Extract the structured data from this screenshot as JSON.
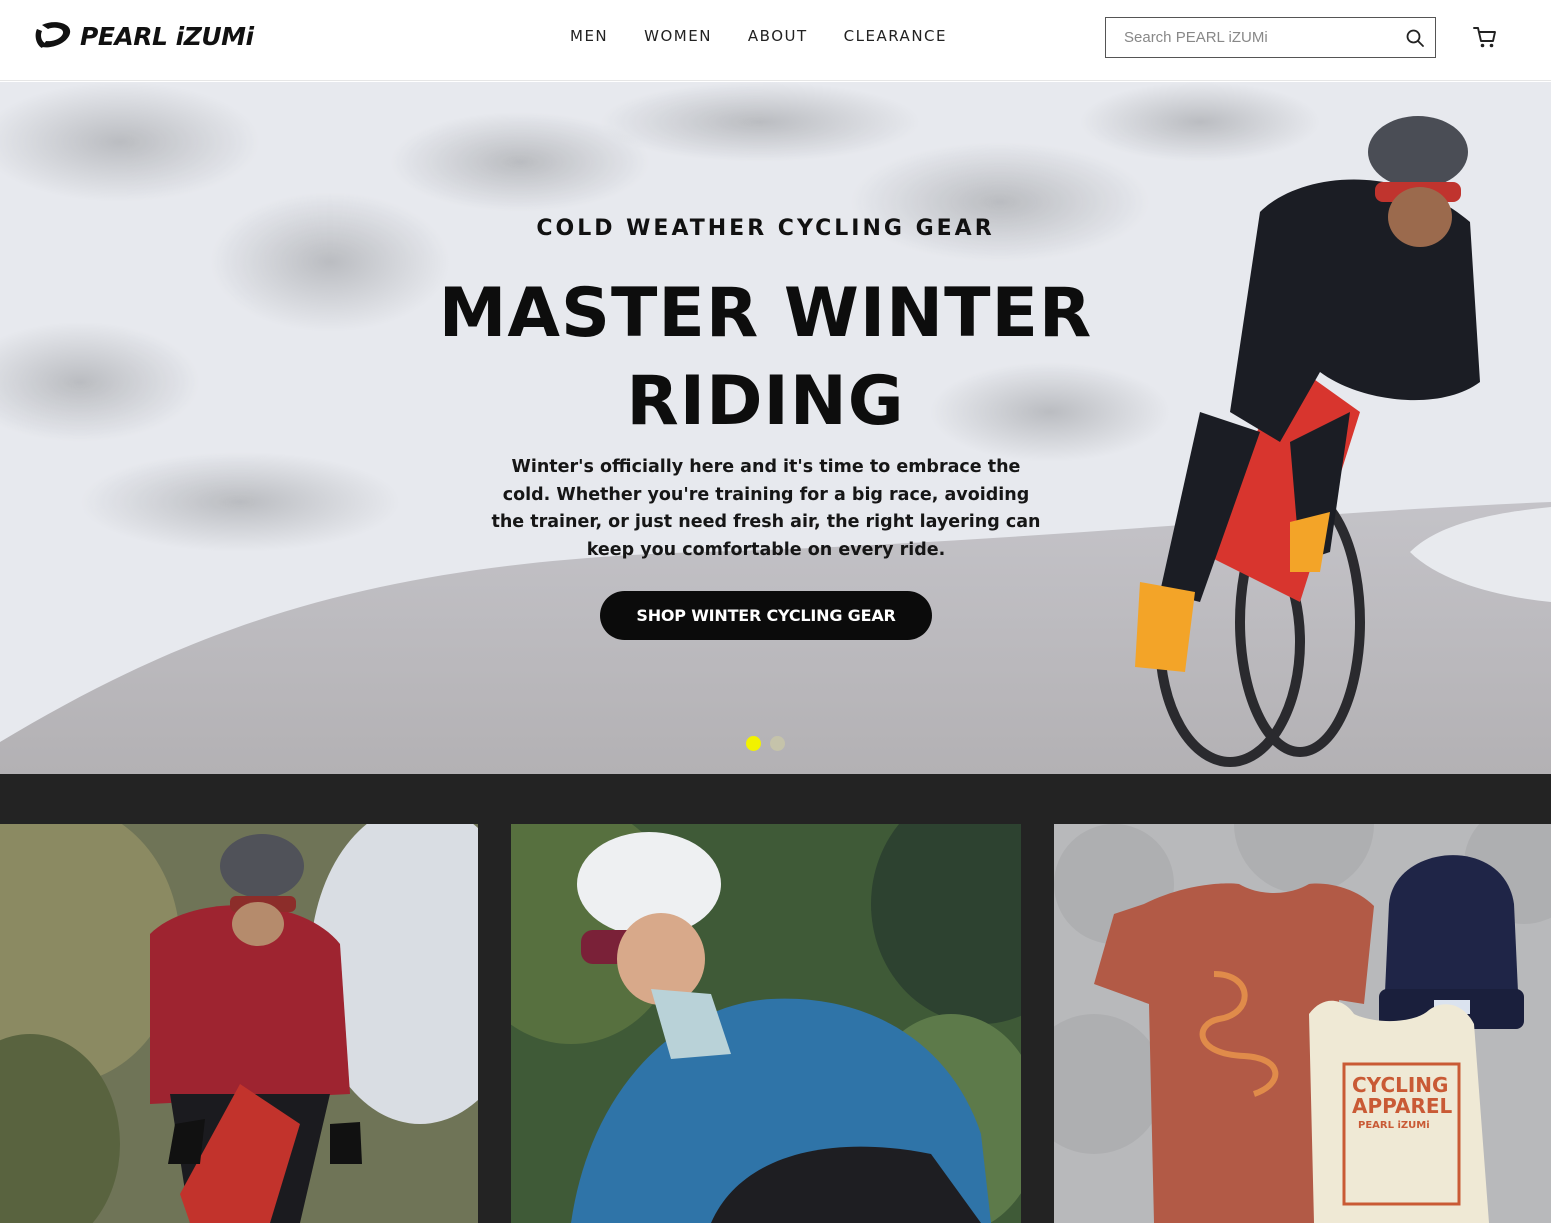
{
  "brand": {
    "name": "PEARL iZUMi"
  },
  "nav": {
    "items": [
      "MEN",
      "WOMEN",
      "ABOUT",
      "CLEARANCE"
    ]
  },
  "search": {
    "placeholder": "Search PEARL iZUMi"
  },
  "icons": {
    "search": "search-icon",
    "cart": "cart-icon",
    "logo": "pearl-izumi-logo-mark"
  },
  "hero": {
    "kicker": "COLD WEATHER CYCLING GEAR",
    "title_line1": "MASTER WINTER",
    "title_line2": "RIDING",
    "body": "Winter's officially here and it's time to embrace the cold. Whether you're training for a big race, avoiding the trainer, or just need fresh air, the right layering can keep you comfortable on every ride.",
    "cta": "SHOP WINTER CYCLING GEAR",
    "carousel": {
      "slides": 2,
      "active": 1
    }
  },
  "tiles": [
    {
      "name": "mens-winter-rider"
    },
    {
      "name": "womens-rider"
    },
    {
      "name": "apparel-collection",
      "printed_text": [
        "CYCLING",
        "APPAREL",
        "PEARL iZUMi"
      ]
    }
  ],
  "colors": {
    "band": "#232323",
    "dot_active": "#f2f200",
    "dot_inactive": "#c9c7a8",
    "cta_bg": "#0b0b0b"
  }
}
